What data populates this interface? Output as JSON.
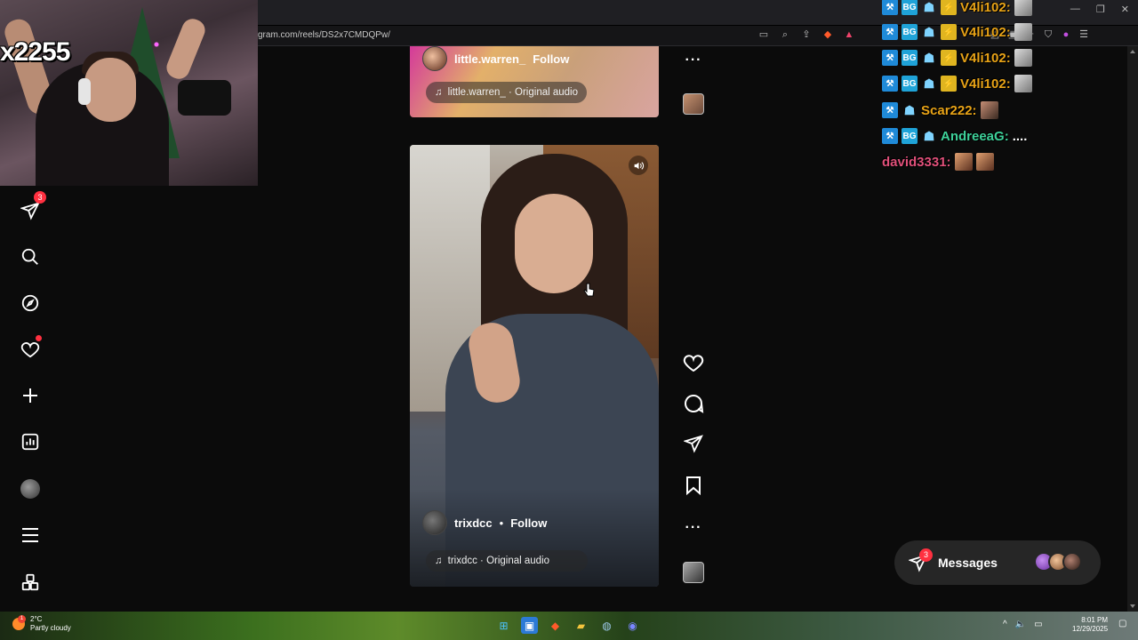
{
  "browser": {
    "url": "gram.com/reels/DS2x7CMDQPw/"
  },
  "stream": {
    "count_overlay": "x2255"
  },
  "nav": {
    "messages_badge": "3"
  },
  "reels": {
    "top": {
      "username": "little.warren_",
      "follow": "Follow",
      "audio": "little.warren_ · Original audio"
    },
    "main": {
      "username": "trixdcc",
      "separator": "•",
      "follow": "Follow",
      "audio": "trixdcc · Original audio"
    },
    "more_label": "···"
  },
  "chat": {
    "lines": [
      {
        "name": "V4li102:",
        "color": "#e8a317"
      },
      {
        "name": "V4li102:",
        "color": "#e8a317"
      },
      {
        "name": "V4li102:",
        "color": "#e8a317"
      },
      {
        "name": "V4li102:",
        "color": "#e8a317"
      },
      {
        "name": "Scar222:",
        "color": "#e8a317"
      },
      {
        "name": "AndreeaG:",
        "color": "#3ed19a",
        "message": "...."
      },
      {
        "name": "david3331:",
        "color": "#e0507a"
      }
    ]
  },
  "messages": {
    "label": "Messages",
    "badge": "3"
  },
  "taskbar": {
    "weather_badge": "1",
    "temp": "2°C",
    "condition": "Partly cloudy",
    "time": "8:01 PM",
    "date": "12/29/2025"
  },
  "colors": {
    "page_bg": "#0b0b0b",
    "badge_red": "#ff3040",
    "pill_bg": "#262626"
  }
}
